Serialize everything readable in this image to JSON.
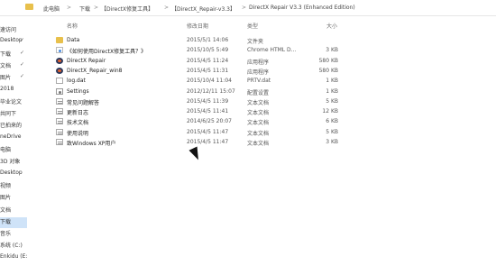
{
  "address": {
    "crumbs": [
      "此电脑",
      "下载",
      "【DirectX修复工具】",
      "【DirectX_Repair-v3.3】",
      "DirectX Repair V3.3 (Enhanced Edition)"
    ],
    "separators": [
      ">",
      ">",
      ">",
      ">"
    ]
  },
  "nav": {
    "items": [
      {
        "label": "速访问",
        "pinned": false,
        "selected": false
      },
      {
        "label": "Desktop",
        "pinned": true,
        "selected": false
      },
      {
        "label": "下载",
        "pinned": true,
        "selected": false
      },
      {
        "label": "文档",
        "pinned": true,
        "selected": false
      },
      {
        "label": "图片",
        "pinned": true,
        "selected": false
      },
      {
        "label": "2018",
        "pinned": false,
        "selected": false
      },
      {
        "label": "毕业论文",
        "pinned": false,
        "selected": false
      },
      {
        "label": "共同下",
        "pinned": false,
        "selected": false
      },
      {
        "label": "已拍来的",
        "pinned": false,
        "selected": false
      },
      {
        "label": "neDrive",
        "pinned": false,
        "selected": false
      },
      {
        "label": "电脑",
        "pinned": false,
        "selected": false
      },
      {
        "label": "3D 对象",
        "pinned": false,
        "selected": false
      },
      {
        "label": "Desktop",
        "pinned": false,
        "selected": false
      },
      {
        "label": "视频",
        "pinned": false,
        "selected": false
      },
      {
        "label": "图片",
        "pinned": false,
        "selected": false
      },
      {
        "label": "文档",
        "pinned": false,
        "selected": false
      },
      {
        "label": "下载",
        "pinned": false,
        "selected": true
      },
      {
        "label": "音乐",
        "pinned": false,
        "selected": false
      },
      {
        "label": "系统 (C:)",
        "pinned": false,
        "selected": false
      },
      {
        "label": "Enkidu (E:)",
        "pinned": false,
        "selected": false
      }
    ],
    "pin_glyph": "✓"
  },
  "columns": {
    "name": "名称",
    "date": "修改日期",
    "type": "类型",
    "size": "大小"
  },
  "files": [
    {
      "name": "Data",
      "date": "2015/5/1 14:06",
      "type": "文件夹",
      "size": "",
      "icon": "folder-icon"
    },
    {
      "name": "《如何使用DirectX修复工具？》",
      "date": "2015/10/5 5:49",
      "type": "Chrome HTML D...",
      "size": "3 KB",
      "icon": "html-file-icon"
    },
    {
      "name": "DirectX Repair",
      "date": "2015/4/5 11:24",
      "type": "应用程序",
      "size": "580 KB",
      "icon": "app-icon"
    },
    {
      "name": "DirectX_Repair_win8",
      "date": "2015/4/5 11:31",
      "type": "应用程序",
      "size": "580 KB",
      "icon": "app-icon"
    },
    {
      "name": "log.dat",
      "date": "2015/10/4 11:04",
      "type": "PRTV.dat",
      "size": "1 KB",
      "icon": "dat-file-icon"
    },
    {
      "name": "Settings",
      "date": "2012/12/11 15:07",
      "type": "配置设置",
      "size": "1 KB",
      "icon": "settings-file-icon"
    },
    {
      "name": "常见问题解答",
      "date": "2015/4/5 11:39",
      "type": "文本文档",
      "size": "5 KB",
      "icon": "text-file-icon"
    },
    {
      "name": "更新日志",
      "date": "2015/4/5 11:41",
      "type": "文本文档",
      "size": "12 KB",
      "icon": "text-file-icon"
    },
    {
      "name": "技术文档",
      "date": "2014/6/25 20:07",
      "type": "文本文档",
      "size": "6 KB",
      "icon": "text-file-icon"
    },
    {
      "name": "使用说明",
      "date": "2015/4/5 11:47",
      "type": "文本文档",
      "size": "5 KB",
      "icon": "text-file-icon"
    },
    {
      "name": "致Windows XP用户",
      "date": "2015/4/5 11:47",
      "type": "文本文档",
      "size": "3 KB",
      "icon": "text-file-icon"
    }
  ],
  "colors": {
    "folder": "#e8c04c",
    "selected_nav": "#cfe3f8",
    "header_text": "#6b6b6b"
  }
}
